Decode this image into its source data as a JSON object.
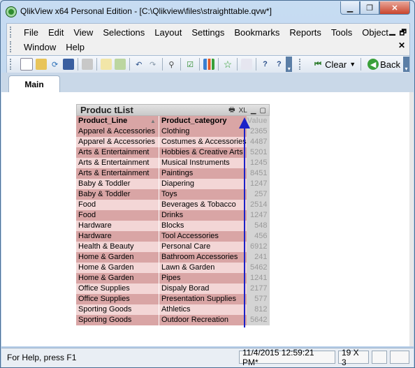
{
  "window": {
    "title": "QlikView x64 Personal Edition - [C:\\Qlikview\\files\\straighttable.qvw*]",
    "min": "▁",
    "restore": "❐",
    "close": "✕"
  },
  "menu": {
    "row1": [
      "File",
      "Edit",
      "View",
      "Selections",
      "Layout",
      "Settings",
      "Bookmarks",
      "Reports",
      "Tools",
      "Object"
    ],
    "row2": [
      "Window",
      "Help"
    ],
    "mdi": {
      "min": "▁",
      "restore": "🗗",
      "close": "✕"
    }
  },
  "toolbar": {
    "clear_label": "Clear",
    "back_label": "Back"
  },
  "tabs": {
    "main": "Main"
  },
  "object": {
    "title": "Produc tList",
    "icons": {
      "print": "🖶",
      "xl": "XL",
      "minimize": "▁",
      "maximize": "▢"
    },
    "headers": [
      "Product_Line",
      "Product_category",
      "Value"
    ],
    "rows": [
      [
        "Apparel & Accessories",
        "Clothing",
        "2365"
      ],
      [
        "Apparel & Accessories",
        "Costumes & Accessories",
        "4487"
      ],
      [
        "Arts & Entertainment",
        "Hobbies & Creative Arts",
        "5201"
      ],
      [
        "Arts & Entertainment",
        "Musical Instruments",
        "1245"
      ],
      [
        "Arts & Entertainment",
        "Paintings",
        "8451"
      ],
      [
        "Baby & Toddler",
        "Diapering",
        "1247"
      ],
      [
        "Baby & Toddler",
        "Toys",
        "257"
      ],
      [
        "Food",
        "Beverages & Tobacco",
        "2514"
      ],
      [
        "Food",
        "Drinks",
        "1247"
      ],
      [
        "Hardware",
        "Blocks",
        "548"
      ],
      [
        "Hardware",
        "Tool Accessories",
        "456"
      ],
      [
        "Health & Beauty",
        "Personal Care",
        "6912"
      ],
      [
        "Home & Garden",
        "Bathroom Accessories",
        "241"
      ],
      [
        "Home & Garden",
        "Lawn & Garden",
        "5462"
      ],
      [
        "Home & Garden",
        "Pipes",
        "1241"
      ],
      [
        "Office Supplies",
        "Dispaly Borad",
        "2177"
      ],
      [
        "Office Supplies",
        "Presentation Supplies",
        "577"
      ],
      [
        "Sporting Goods",
        "Athletics",
        "812"
      ],
      [
        "Sporting Goods",
        "Outdoor Recreation",
        "5642"
      ]
    ]
  },
  "status": {
    "help": "For Help, press F1",
    "datetime": "11/4/2015 12:59:21 PM*",
    "dims": "19 X 3"
  },
  "colors": {
    "accent_arrow": "#1a22c8",
    "row_dark": "#d9a5a5",
    "row_light": "#f3d6d6",
    "value_col": "#d4d4d4"
  }
}
